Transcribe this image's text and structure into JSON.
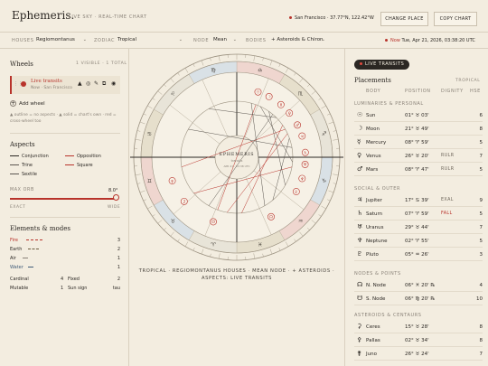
{
  "header": {
    "brand": "Ephemeris.",
    "subtitle": "LIVE SKY · REAL-TIME CHART",
    "location": "San Francisco · 37.77°N, 122.42°W",
    "change_place": "CHANGE PLACE",
    "copy_chart": "COPY CHART"
  },
  "settings": {
    "houses_label": "HOUSES",
    "houses_value": "Regiomontanus",
    "zodiac_label": "ZODIAC",
    "zodiac_value": "Tropical",
    "node_label": "NODE",
    "node_value": "Mean",
    "bodies_label": "BODIES",
    "bodies_value": "+ Asteroids & Chiron",
    "now_label": "Now",
    "now_value": "Tue, Apr 21, 2026, 03:38:20 UTC"
  },
  "wheels": {
    "title": "Wheels",
    "count": "1 VISIBLE · 1 TOTAL",
    "item_name": "Live transits",
    "item_sub": "Now · San Francisco",
    "add": "Add wheel",
    "legend": "▲ outline = no aspects · ▲ solid = chart's own · red = cross-wheel too"
  },
  "aspects": {
    "title": "Aspects",
    "items": [
      {
        "label": "Conjunction",
        "color": "#2b2723"
      },
      {
        "label": "Opposition",
        "color": "#b8332b"
      },
      {
        "label": "Trine",
        "color": "#5b5650"
      },
      {
        "label": "Square",
        "color": "#b8332b"
      },
      {
        "label": "Sextile",
        "color": "#5b5650"
      }
    ],
    "orb_label": "MAX ORB",
    "orb_value": "8.0°",
    "exact": "EXACT",
    "wide": "WIDE"
  },
  "elements": {
    "title": "Elements & modes",
    "rows": [
      {
        "label": "Fire",
        "count": "3",
        "color": "#b8332b"
      },
      {
        "label": "Earth",
        "count": "2",
        "color": "#6b5d3f"
      },
      {
        "label": "Air",
        "count": "1",
        "color": "#8a8278"
      },
      {
        "label": "Water",
        "count": "1",
        "color": "#3f5b78"
      }
    ],
    "cardinal": "Cardinal",
    "cardinal_n": "4",
    "fixed": "Fixed",
    "fixed_n": "2",
    "mutable": "Mutable",
    "mutable_n": "1",
    "sun_sign": "Sun sign",
    "sun_sign_value": "tau"
  },
  "wheel": {
    "center_title": "EPHEMERIS",
    "center_sub": "transits",
    "center_date": "APR 21 · 03:38 UTC",
    "caption": "TROPICAL · REGIOMONTANUS HOUSES · MEAN NODE · + ASTEROIDS · ASPECTS: LIVE TRANSITS"
  },
  "placements": {
    "live_pill": "LIVE TRANSITS",
    "title": "Placements",
    "zodiac": "TROPICAL",
    "col_body": "BODY",
    "col_pos": "POSITION",
    "col_dig": "DIGNITY",
    "col_hse": "HSE",
    "group1": "LUMINARIES & PERSONAL",
    "group2": "SOCIAL & OUTER",
    "group3": "NODES & POINTS",
    "group4": "ASTEROIDS & CENTAURS",
    "rows": [
      {
        "glyph": "☉",
        "name": "Sun",
        "pos": "01° ♉ 03'",
        "dig": "",
        "hse": "6"
      },
      {
        "glyph": "☽",
        "name": "Moon",
        "pos": "21° ♉ 49'",
        "dig": "",
        "hse": "8"
      },
      {
        "glyph": "☿",
        "name": "Mercury",
        "pos": "08° ♈ 59'",
        "dig": "",
        "hse": "5"
      },
      {
        "glyph": "♀",
        "name": "Venus",
        "pos": "26° ♉ 20'",
        "dig": "RULR",
        "hse": "7"
      },
      {
        "glyph": "♂",
        "name": "Mars",
        "pos": "08° ♈ 47'",
        "dig": "RULR",
        "hse": "5"
      },
      {
        "glyph": "♃",
        "name": "Jupiter",
        "pos": "17° ♋ 39'",
        "dig": "EXAL",
        "hse": "9"
      },
      {
        "glyph": "♄",
        "name": "Saturn",
        "pos": "07° ♈ 59'",
        "dig": "FALL",
        "hse": "5"
      },
      {
        "glyph": "♅",
        "name": "Uranus",
        "pos": "29° ♉ 44'",
        "dig": "",
        "hse": "7"
      },
      {
        "glyph": "♆",
        "name": "Neptune",
        "pos": "02° ♈ 55'",
        "dig": "",
        "hse": "5"
      },
      {
        "glyph": "♇",
        "name": "Pluto",
        "pos": "05° ♒ 26'",
        "dig": "",
        "hse": "3"
      },
      {
        "glyph": "☊",
        "name": "N. Node",
        "pos": "06° ♓ 20' ℞",
        "dig": "",
        "hse": "4"
      },
      {
        "glyph": "☋",
        "name": "S. Node",
        "pos": "06° ♍ 20' ℞",
        "dig": "",
        "hse": "10"
      },
      {
        "glyph": "⚳",
        "name": "Ceres",
        "pos": "15° ♉ 28'",
        "dig": "",
        "hse": "8"
      },
      {
        "glyph": "⚴",
        "name": "Pallas",
        "pos": "02° ♉ 34'",
        "dig": "",
        "hse": "8"
      },
      {
        "glyph": "⚵",
        "name": "Juno",
        "pos": "26° ♉ 24'",
        "dig": "",
        "hse": "7"
      }
    ]
  }
}
